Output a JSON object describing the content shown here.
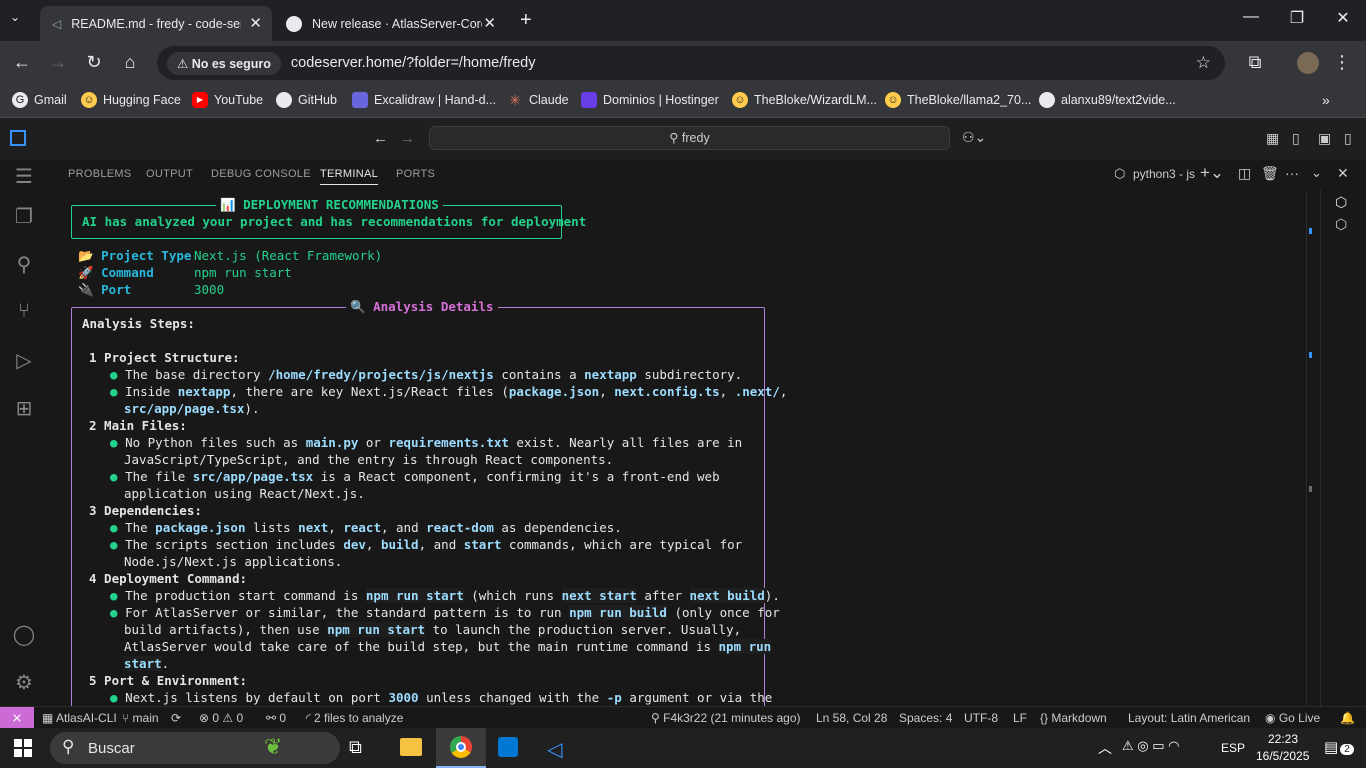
{
  "browser": {
    "tabs": [
      {
        "title": "README.md - fredy - code-serv",
        "active": true
      },
      {
        "title": "New release · AtlasServer-Core/",
        "active": false
      }
    ],
    "security_label": "No es seguro",
    "url": "codeserver.home/?folder=/home/fredy",
    "bookmarks": [
      "Gmail",
      "Hugging Face",
      "YouTube",
      "GitHub",
      "Excalidraw | Hand-d...",
      "Claude",
      "Dominios | Hostinger",
      "TheBloke/WizardLM...",
      "TheBloke/llama2_70...",
      "alanxu89/text2vide..."
    ]
  },
  "editor": {
    "command_center": "fredy",
    "panel_tabs": [
      "PROBLEMS",
      "OUTPUT",
      "DEBUG CONSOLE",
      "TERMINAL",
      "PORTS"
    ],
    "active_panel_tab": "TERMINAL",
    "terminal_name": "python3 - js"
  },
  "terminal": {
    "banner_title": "📊 DEPLOYMENT RECOMMENDATIONS",
    "banner_text": "AI has analyzed your project and has recommendations for deployment",
    "project_type_label": "📂 Project Type",
    "project_type_value": "Next.js (React Framework)",
    "command_label": "🚀 Command",
    "command_value": "npm run start",
    "port_label": "🔌 Port",
    "port_value": "3000",
    "details_title": "🔍 Analysis Details",
    "steps_heading": "Analysis Steps:",
    "s1_title": "1 Project Structure:",
    "s1_b1a": "The base directory ",
    "s1_b1b": "/home/fredy/projects/js/nextjs",
    "s1_b1c": " contains a ",
    "s1_b1d": "nextapp",
    "s1_b1e": " subdirectory.",
    "s1_b2a": "Inside ",
    "s1_b2b": "nextapp",
    "s1_b2c": ", there are key Next.js/React files (",
    "s1_b2d": "package.json",
    "s1_b2e": ", ",
    "s1_b2f": "next.config.ts",
    "s1_b2g": ", ",
    "s1_b2h": ".next/",
    "s1_b2i": ",",
    "s1_b2j": "src/app/page.tsx",
    "s1_b2k": ").",
    "s2_title": "2 Main Files:",
    "s2_b1a": "No Python files such as ",
    "s2_b1b": "main.py",
    "s2_b1c": " or ",
    "s2_b1d": "requirements.txt",
    "s2_b1e": " exist. Nearly all files are in",
    "s2_b1f": "JavaScript/TypeScript, and the entry is through React components.",
    "s2_b2a": "The file ",
    "s2_b2b": "src/app/page.tsx",
    "s2_b2c": " is a React component, confirming it's a front-end web",
    "s2_b2d": "application using React/Next.js.",
    "s3_title": "3 Dependencies:",
    "s3_b1a": "The ",
    "s3_b1b": "package.json",
    "s3_b1c": " lists ",
    "s3_b1d": "next",
    "s3_b1e": ", ",
    "s3_b1f": "react",
    "s3_b1g": ", and ",
    "s3_b1h": "react-dom",
    "s3_b1i": " as dependencies.",
    "s3_b2a": "The scripts section includes ",
    "s3_b2b": "dev",
    "s3_b2c": ", ",
    "s3_b2d": "build",
    "s3_b2e": ", and ",
    "s3_b2f": "start",
    "s3_b2g": " commands, which are typical for",
    "s3_b2h": "Node.js/Next.js applications.",
    "s4_title": "4 Deployment Command:",
    "s4_b1a": "The production start command is ",
    "s4_b1b": "npm run start",
    "s4_b1c": " (which runs ",
    "s4_b1d": "next start",
    "s4_b1e": " after ",
    "s4_b1f": "next build",
    "s4_b1g": ").",
    "s4_b2a": "For AtlasServer or similar, the standard pattern is to run ",
    "s4_b2b": "npm run build",
    "s4_b2c": " (only once for",
    "s4_b2d": "build artifacts), then use ",
    "s4_b2e": "npm run start",
    "s4_b2f": " to launch the production server. Usually,",
    "s4_b2g": "AtlasServer would take care of the build step, but the main runtime command is ",
    "s4_b2h": "npm run",
    "s4_b2i": "start",
    "s4_b2j": ".",
    "s5_title": "5 Port & Environment:",
    "s5_b1a": "Next.js listens by default on port ",
    "s5_b1b": "3000",
    "s5_b1c": " unless changed with the ",
    "s5_b1d": "-p",
    "s5_b1e": " argument or via the"
  },
  "statusbar": {
    "extension": "AtlasAI-CLI",
    "branch": "main",
    "errors": "0",
    "warnings": "0",
    "ports": "0",
    "analyze": "2 files to analyze",
    "commit": "F4k3r22 (21 minutes ago)",
    "position": "Ln 58, Col 28",
    "spaces": "Spaces: 4",
    "encoding": "UTF-8",
    "eol": "LF",
    "language": "Markdown",
    "layout": "Layout: Latin American",
    "golive": "Go Live"
  },
  "taskbar": {
    "search_placeholder": "Buscar",
    "lang": "ESP",
    "time": "22:23",
    "date": "16/5/2025",
    "notif_count": "2"
  },
  "colors": {
    "accent": "#0078d4",
    "remote": "#cc6bd6",
    "terminal_green": "#23d18b",
    "terminal_purple": "#b180d7"
  }
}
